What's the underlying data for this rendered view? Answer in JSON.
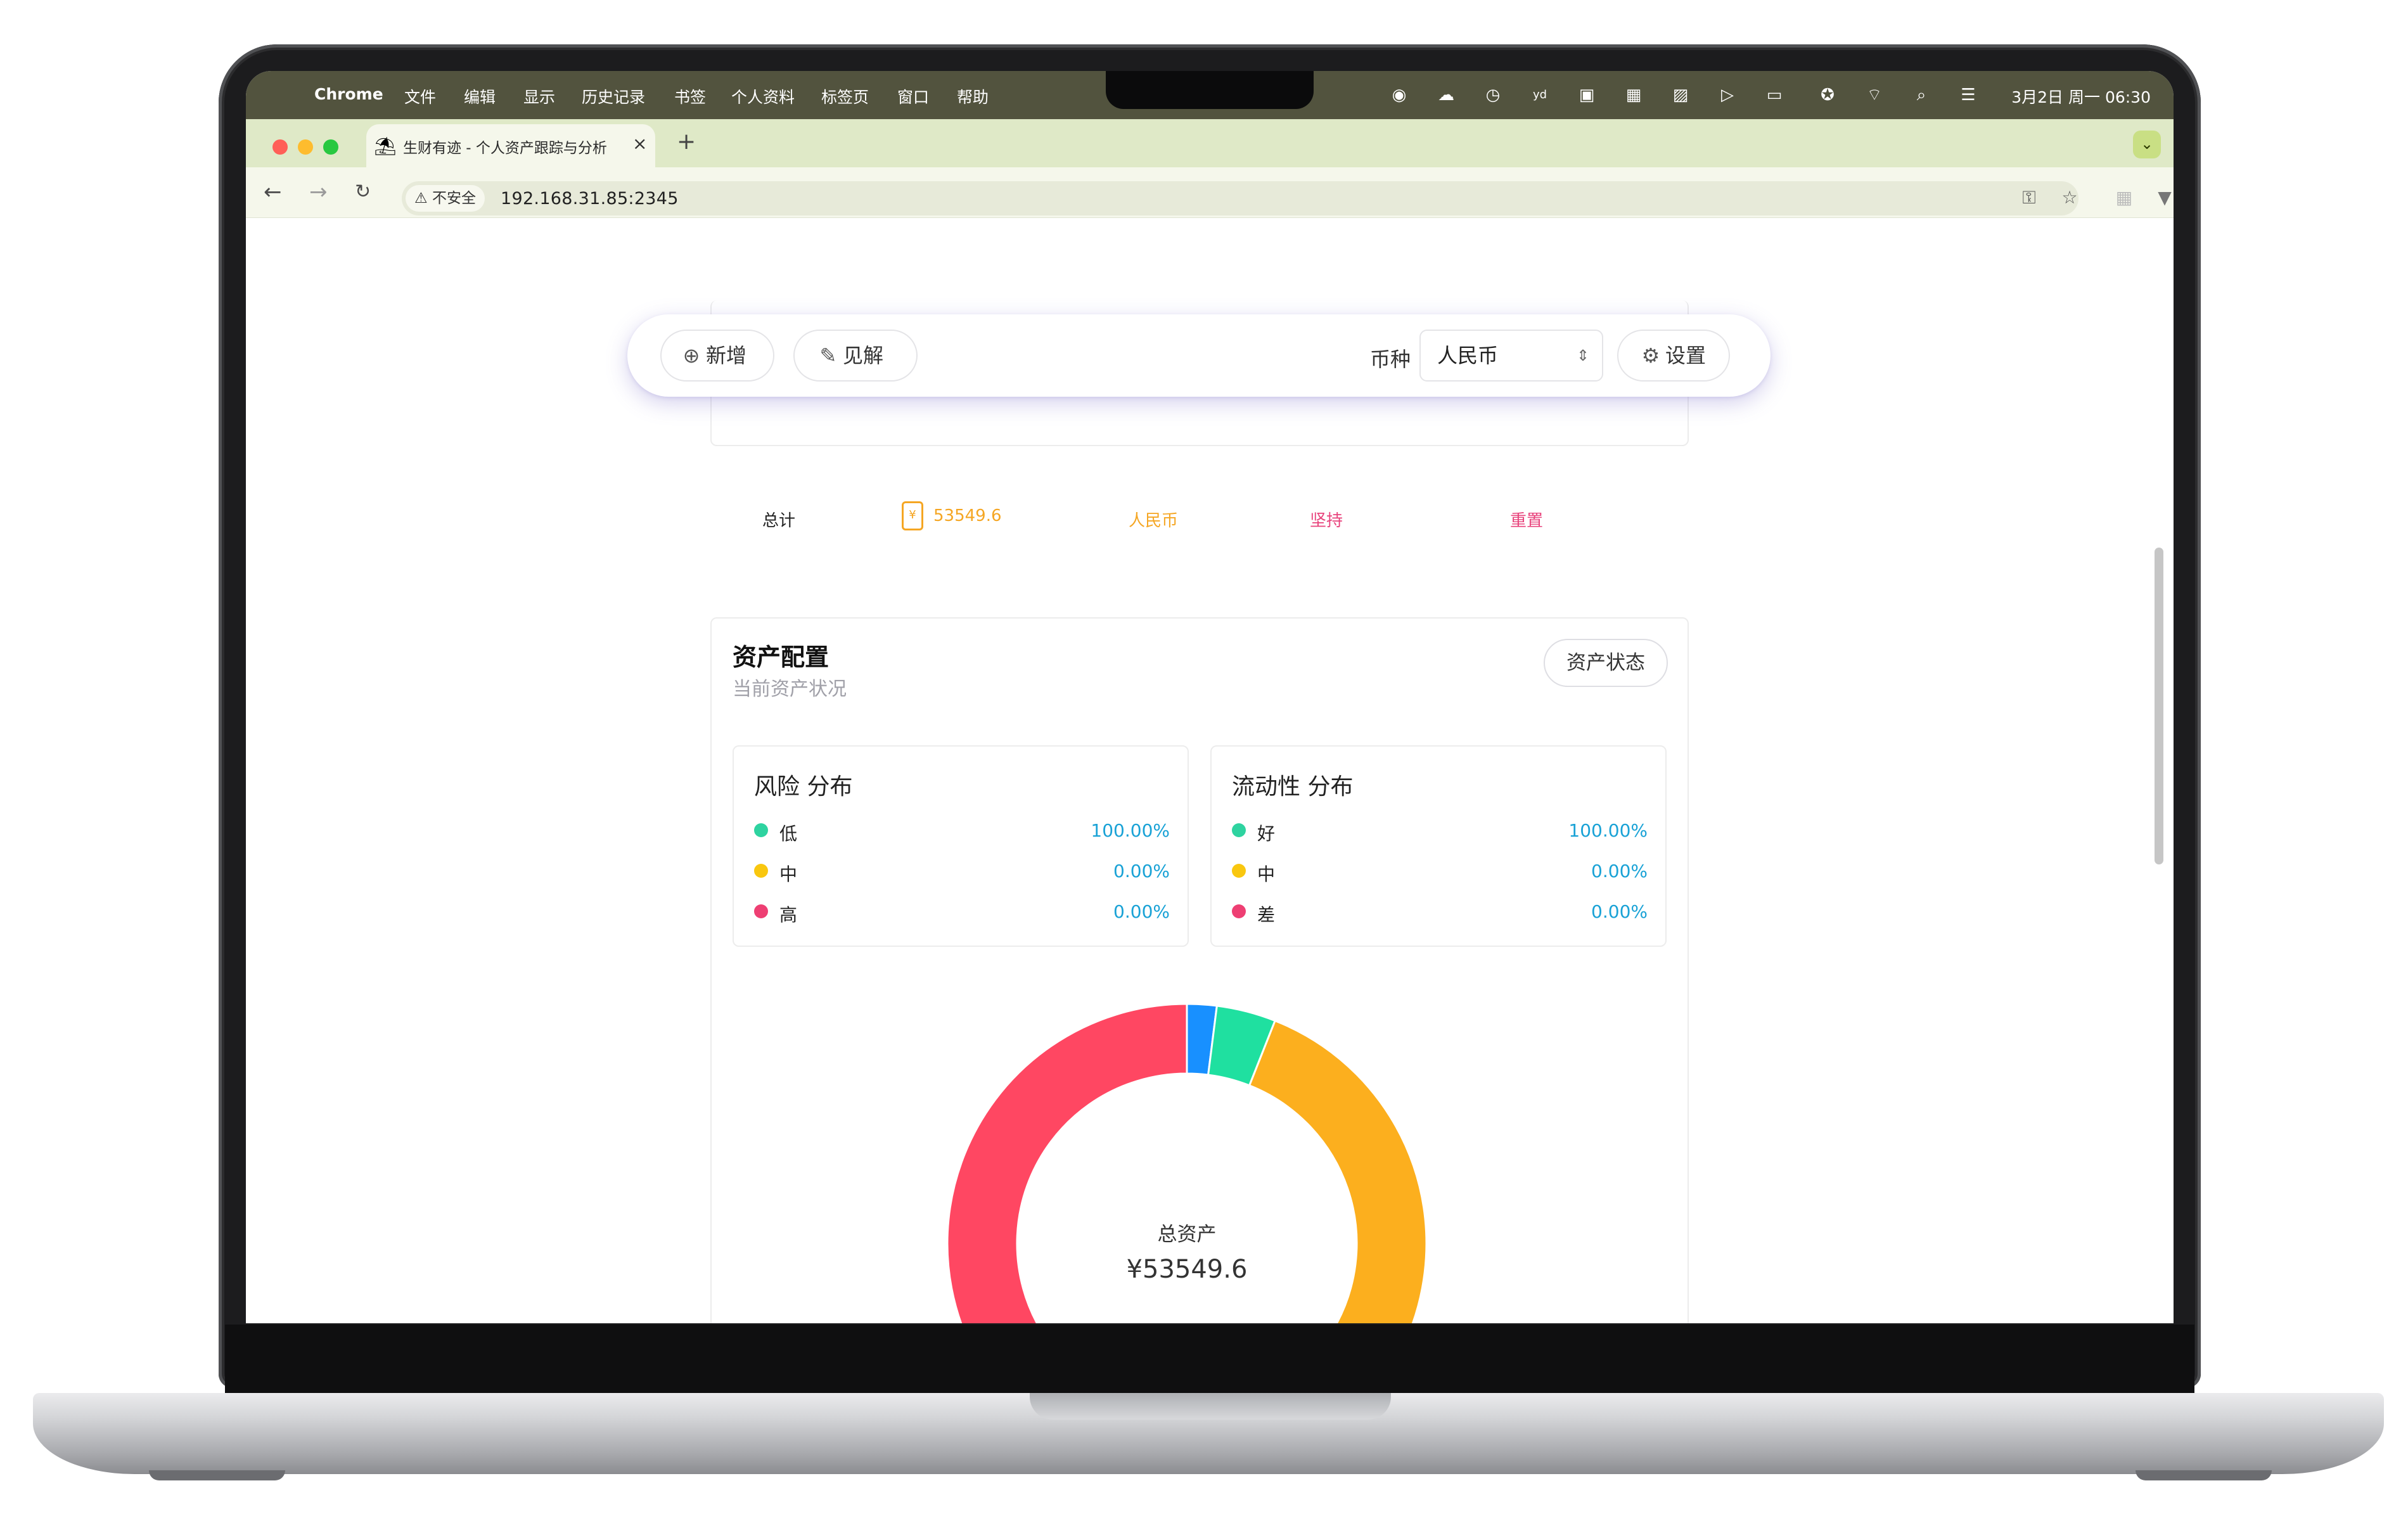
{
  "menubar": {
    "app_name": "Chrome",
    "items": [
      "文件",
      "编辑",
      "显示",
      "历史记录",
      "书签",
      "个人资料",
      "标签页",
      "窗口",
      "帮助"
    ],
    "clock": "3月2日 周一  06:30"
  },
  "browser": {
    "tab_title": "生财有迹 - 个人资产跟踪与分析",
    "security_label": "不安全",
    "url": "192.168.31.85:2345"
  },
  "toolbar_float": {
    "add_label": "新增",
    "insight_label": "见解",
    "currency_label": "币种",
    "currency_value": "人民币",
    "settings_label": "设置"
  },
  "summary": {
    "total_label": "总计",
    "currency_symbol": "¥",
    "total_amount": "53549.6",
    "currency": "人民币",
    "hold": "坚持",
    "reset": "重置"
  },
  "allocation": {
    "title": "资产配置",
    "subtitle": "当前资产状况",
    "status_button": "资产状态",
    "risk": {
      "title": "风险 分布",
      "rows": [
        {
          "label": "低",
          "value": "100.00%",
          "color": "#2ed3a0"
        },
        {
          "label": "中",
          "value": "0.00%",
          "color": "#f9c70f"
        },
        {
          "label": "高",
          "value": "0.00%",
          "color": "#ee3f73"
        }
      ]
    },
    "liquidity": {
      "title": "流动性 分布",
      "rows": [
        {
          "label": "好",
          "value": "100.00%",
          "color": "#2ed3a0"
        },
        {
          "label": "中",
          "value": "0.00%",
          "color": "#f9c70f"
        },
        {
          "label": "差",
          "value": "0.00%",
          "color": "#ee3f73"
        }
      ]
    },
    "donut_caption": "总资产",
    "donut_value": "¥53549.6"
  },
  "chart_data": {
    "type": "pie",
    "donut": true,
    "categories": [
      "",
      "",
      "",
      ""
    ],
    "values": [
      2,
      4,
      55,
      39
    ],
    "colors": [
      "#1890ff",
      "#1fe0a0",
      "#fcaf1e",
      "#ff4762"
    ]
  }
}
